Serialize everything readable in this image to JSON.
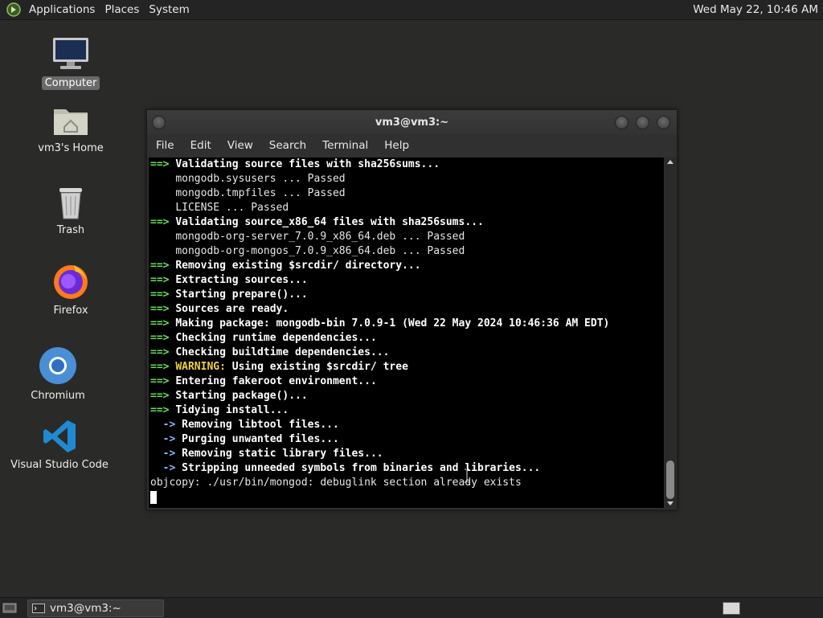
{
  "top_panel": {
    "menus": [
      "Applications",
      "Places",
      "System"
    ],
    "clock": "Wed May 22, 10:46 AM"
  },
  "desktop": {
    "icons": [
      {
        "label": "Computer",
        "icon": "computer-icon",
        "selected": true
      },
      {
        "label": "vm3's Home",
        "icon": "home-folder-icon"
      },
      {
        "label": "Trash",
        "icon": "trash-icon"
      },
      {
        "label": "Firefox",
        "icon": "firefox-icon"
      },
      {
        "label": "Chromium",
        "icon": "chromium-icon"
      },
      {
        "label": "Visual Studio Code",
        "icon": "vscode-icon"
      }
    ]
  },
  "window": {
    "title": "vm3@vm3:~",
    "menu": [
      "File",
      "Edit",
      "View",
      "Search",
      "Terminal",
      "Help"
    ]
  },
  "terminal": {
    "lines": [
      {
        "prefix": "==> ",
        "kind": "arrow",
        "text": "Validating source files with sha256sums..."
      },
      {
        "prefix": "    ",
        "kind": "plain",
        "text": "mongodb.sysusers ... Passed"
      },
      {
        "prefix": "    ",
        "kind": "plain",
        "text": "mongodb.tmpfiles ... Passed"
      },
      {
        "prefix": "    ",
        "kind": "plain",
        "text": "LICENSE ... Passed"
      },
      {
        "prefix": "==> ",
        "kind": "arrow",
        "text": "Validating source_x86_64 files with sha256sums..."
      },
      {
        "prefix": "    ",
        "kind": "plain",
        "text": "mongodb-org-server_7.0.9_x86_64.deb ... Passed"
      },
      {
        "prefix": "    ",
        "kind": "plain",
        "text": "mongodb-org-mongos_7.0.9_x86_64.deb ... Passed"
      },
      {
        "prefix": "==> ",
        "kind": "arrow",
        "text": "Removing existing $srcdir/ directory..."
      },
      {
        "prefix": "==> ",
        "kind": "arrow",
        "text": "Extracting sources..."
      },
      {
        "prefix": "==> ",
        "kind": "arrow",
        "text": "Starting prepare()..."
      },
      {
        "prefix": "==> ",
        "kind": "arrow",
        "text": "Sources are ready."
      },
      {
        "prefix": "==> ",
        "kind": "arrow",
        "text": "Making package: mongodb-bin 7.0.9-1 (Wed 22 May 2024 10:46:36 AM EDT)"
      },
      {
        "prefix": "==> ",
        "kind": "arrow",
        "text": "Checking runtime dependencies..."
      },
      {
        "prefix": "==> ",
        "kind": "arrow",
        "text": "Checking buildtime dependencies..."
      },
      {
        "prefix": "==> ",
        "kind": "warn",
        "label": "WARNING:",
        "text": " Using existing $srcdir/ tree"
      },
      {
        "prefix": "==> ",
        "kind": "arrow",
        "text": "Entering fakeroot environment..."
      },
      {
        "prefix": "==> ",
        "kind": "arrow",
        "text": "Starting package()..."
      },
      {
        "prefix": "==> ",
        "kind": "arrow",
        "text": "Tidying install..."
      },
      {
        "prefix": "  -> ",
        "kind": "sub",
        "text": "Removing libtool files..."
      },
      {
        "prefix": "  -> ",
        "kind": "sub",
        "text": "Purging unwanted files..."
      },
      {
        "prefix": "  -> ",
        "kind": "sub",
        "text": "Removing static library files..."
      },
      {
        "prefix": "  -> ",
        "kind": "sub",
        "text": "Stripping unneeded symbols from binaries and libraries..."
      },
      {
        "prefix": "",
        "kind": "plain",
        "text": "objcopy: ./usr/bin/mongod: debuglink section already exists"
      }
    ]
  },
  "taskbar": {
    "task_label": "vm3@vm3:~"
  },
  "colors": {
    "arrow": "#68e05a",
    "sub_arrow": "#8fb3ff",
    "warning": "#f0d040",
    "terminal_bg": "#000000"
  }
}
